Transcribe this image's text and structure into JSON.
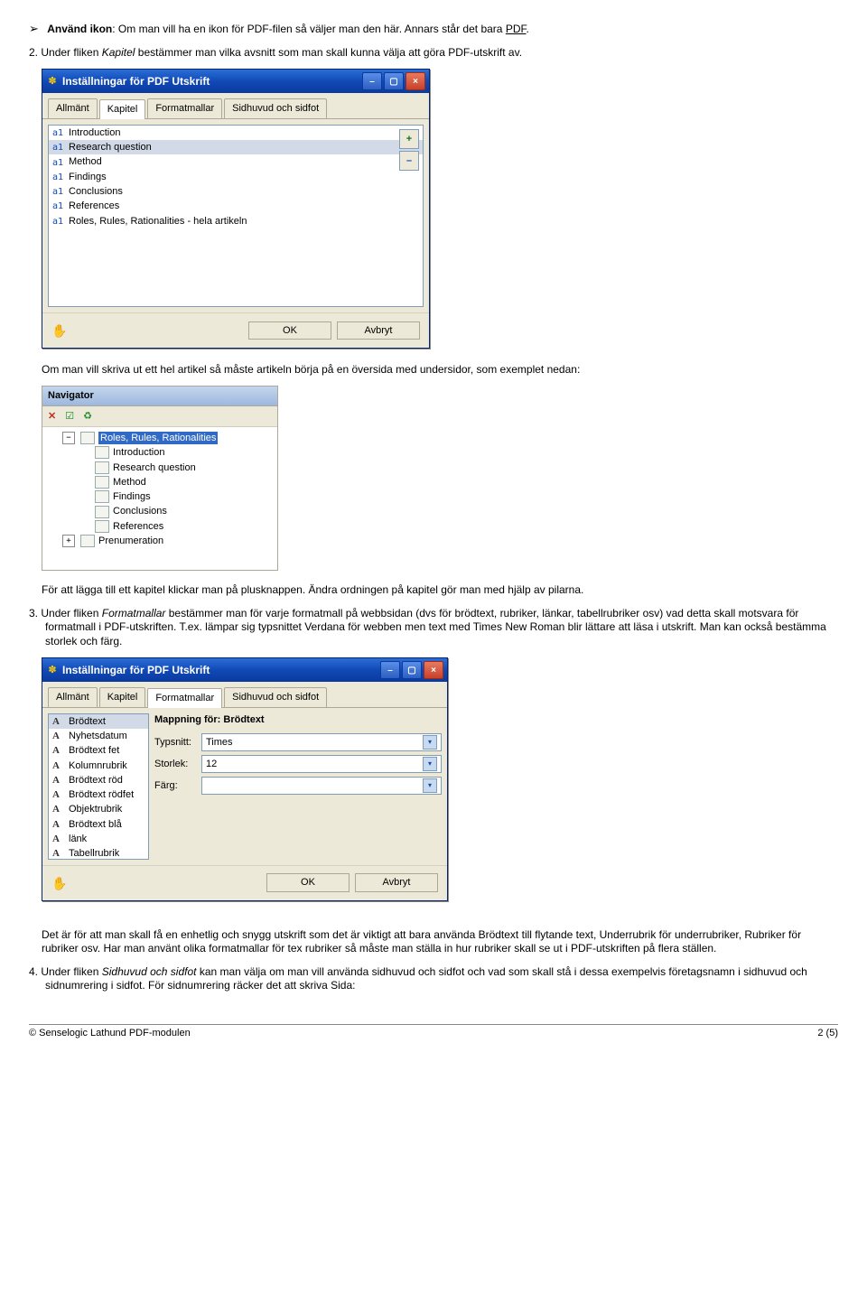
{
  "para1": {
    "lead_bold": "Använd ikon",
    "after_lead": ": Om man vill ha en ikon för PDF-filen så väljer man den här. Annars står det bara ",
    "underlined": "PDF"
  },
  "item2": {
    "num": "2.",
    "pre": "Under fliken ",
    "italic": "Kapitel",
    "post": " bestämmer man vilka avsnitt som man skall kunna välja att göra PDF-utskrift av."
  },
  "dialog_title": "Inställningar för PDF Utskrift",
  "tabs": {
    "t0": "Allmänt",
    "t1": "Kapitel",
    "t2": "Formatmallar",
    "t3": "Sidhuvud och sidfot"
  },
  "kapitel_list": {
    "i0": "Introduction",
    "i1": "Research question",
    "i2": "Method",
    "i3": "Findings",
    "i4": "Conclusions",
    "i5": "References",
    "i6": "Roles, Rules, Rationalities - hela artikeln"
  },
  "btn_ok": "OK",
  "btn_cancel": "Avbryt",
  "middle_para": "Om man vill skriva ut ett hel artikel så måste artikeln börja på en översida med undersidor, som exemplet nedan:",
  "nav_title": "Navigator",
  "tree": {
    "top": "Roles, Rules, Rationalities",
    "c1": "Introduction",
    "c2": "Research question",
    "c3": "Method",
    "c4": "Findings",
    "c5": "Conclusions",
    "c6": "References",
    "sibling": "Prenumeration"
  },
  "after_nav": "För att lägga till ett kapitel klickar man på plusknappen. Ändra ordningen på kapitel gör man med hjälp av pilarna.",
  "item3": {
    "num": "3.",
    "pre": "Under fliken ",
    "italic": "Formatmallar ",
    "post": " bestämmer man för varje formatmall på webbsidan (dvs för brödtext, rubriker, länkar, tabellrubriker osv) vad detta skall motsvara för formatmall i PDF-utskriften. T.ex. lämpar sig typsnittet Verdana för webben men text med Times New Roman blir lättare att läsa i utskrift. Man kan också bestämma storlek och färg."
  },
  "fm_list": {
    "i0": "Brödtext",
    "i1": "Nyhetsdatum",
    "i2": "Brödtext fet",
    "i3": "Kolumnrubrik",
    "i4": "Brödtext röd",
    "i5": "Brödtext rödfet",
    "i6": "Objektrubrik",
    "i7": "Brödtext blå",
    "i8": "länk",
    "i9": "Tabellrubrik"
  },
  "mapping": {
    "title_prefix": "Mappning för: ",
    "title_target": "Brödtext",
    "font_label": "Typsnitt:",
    "font_value": "Times",
    "size_label": "Storlek:",
    "size_value": "12",
    "color_label": "Färg:",
    "color_value": ""
  },
  "bottom_para": "Det är för att man skall få en enhetlig och snygg utskrift som det är viktigt att bara använda Brödtext till flytande text, Underrubrik för underrubriker, Rubriker för rubriker osv. Har man använt olika formatmallar för tex rubriker så måste man ställa in hur rubriker skall se ut i PDF-utskriften på flera ställen.",
  "item4": {
    "num": "4.",
    "pre": "Under fliken ",
    "italic": "Sidhuvud och sidfot",
    "post": " kan man välja om man vill använda sidhuvud och sidfot och vad som skall stå i dessa exempelvis företagsnamn i sidhuvud och sidnumrering i sidfot. För sidnumrering räcker det att skriva Sida:"
  },
  "footer_left": "© Senselogic Lathund PDF-modulen",
  "footer_right": "2 (5)"
}
